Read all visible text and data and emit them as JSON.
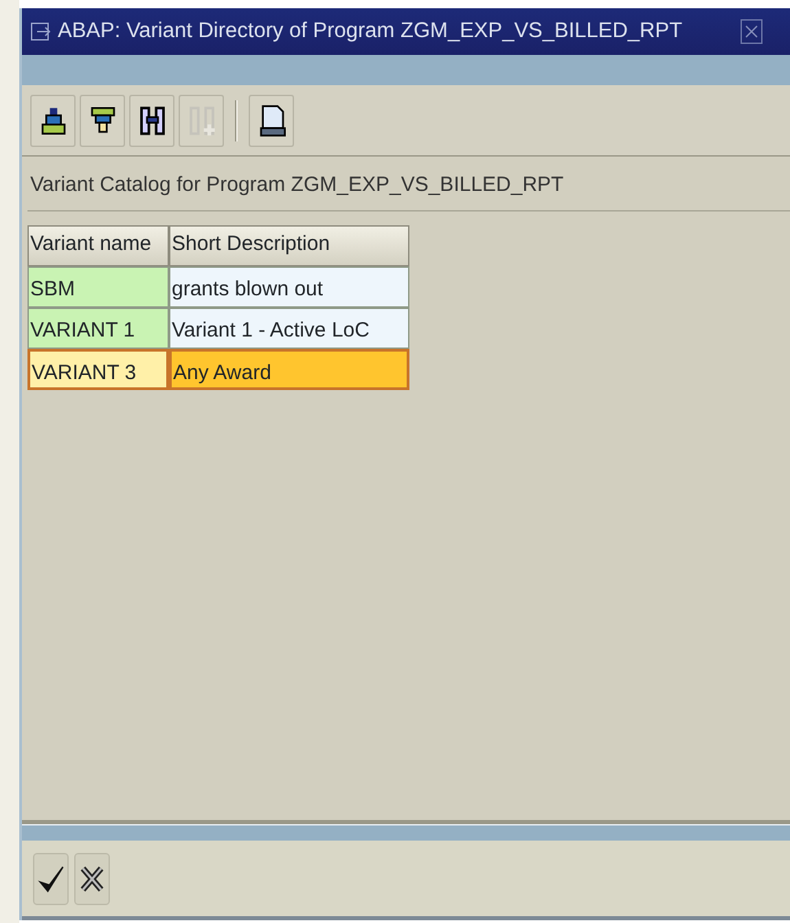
{
  "window": {
    "title": "ABAP: Variant Directory of Program ZGM_EXP_VS_BILLED_RPT"
  },
  "toolbar": [
    [
      {
        "kind": "sort-up",
        "disabled": false
      },
      {
        "kind": "sort-down",
        "disabled": false
      },
      {
        "kind": "find",
        "disabled": false
      },
      {
        "kind": "find-next",
        "disabled": true
      }
    ],
    [
      {
        "kind": "print",
        "disabled": false
      }
    ]
  ],
  "catalog_label": "Variant Catalog for Program ZGM_EXP_VS_BILLED_RPT",
  "table": {
    "columns": [
      "Variant name",
      "Short Description"
    ],
    "rows": [
      {
        "cells": [
          "SBM",
          "grants blown out"
        ],
        "selected": false
      },
      {
        "cells": [
          "VARIANT 1",
          "Variant 1 - Active LoC"
        ],
        "selected": false
      },
      {
        "cells": [
          "VARIANT 3",
          "Any Award"
        ],
        "selected": true
      }
    ]
  },
  "footer_buttons": [
    {
      "kind": "confirm"
    },
    {
      "kind": "cancel"
    }
  ]
}
